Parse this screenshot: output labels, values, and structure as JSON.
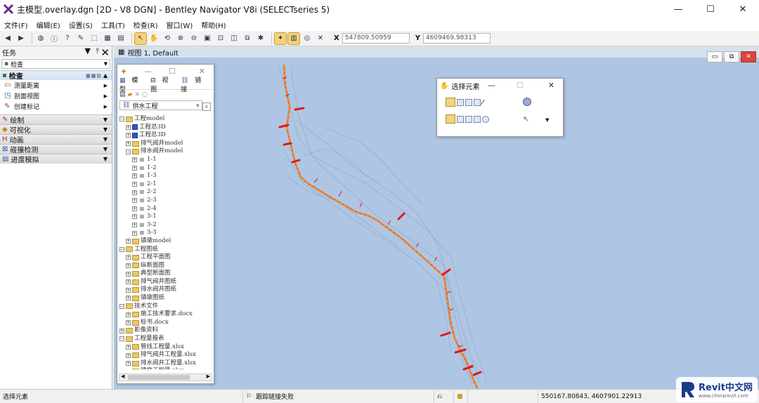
{
  "window": {
    "title": "主模型.overlay.dgn [2D - V8 DGN] - Bentley Navigator V8i (SELECTseries 5)",
    "minimize": "—",
    "maximize": "☐",
    "close": "✕"
  },
  "menu": [
    "文件(F)",
    "编辑(E)",
    "设置(S)",
    "工具(T)",
    "检查(R)",
    "窗口(W)",
    "帮助(H)"
  ],
  "toolbar": {
    "x_label": "X",
    "x_value": "547809.50959",
    "y_label": "Y",
    "y_value": "4609469.98313"
  },
  "task_panel": {
    "title": "任务",
    "select_value": "检查",
    "groups": [
      {
        "label": "检查",
        "expanded": true,
        "items": [
          "测量距离",
          "剖面视图",
          "创建标记"
        ]
      },
      {
        "label": "绘制",
        "expanded": false
      },
      {
        "label": "可视化",
        "expanded": false
      },
      {
        "label": "动画",
        "expanded": false
      },
      {
        "label": "碰撞检测",
        "expanded": false
      },
      {
        "label": "进度模拟",
        "expanded": false
      }
    ]
  },
  "view": {
    "title": "视图 1, Default"
  },
  "links_window": {
    "tabs": [
      "模型",
      "视图",
      "链接"
    ],
    "select_value": "供水工程",
    "tree": [
      {
        "level": 0,
        "label": "工程model",
        "icon": "folder",
        "exp": "−"
      },
      {
        "level": 1,
        "label": "工程总3D",
        "icon": "doc",
        "exp": "+"
      },
      {
        "level": 1,
        "label": "工程总3D",
        "icon": "doc",
        "exp": "+"
      },
      {
        "level": 1,
        "label": "排气阀井model",
        "icon": "folder",
        "exp": "+"
      },
      {
        "level": 1,
        "label": "排水阀井model",
        "icon": "folder",
        "exp": "−"
      },
      {
        "level": 2,
        "label": "1-1",
        "icon": "link",
        "exp": "+"
      },
      {
        "level": 2,
        "label": "1-2",
        "icon": "link",
        "exp": "+"
      },
      {
        "level": 2,
        "label": "1-3",
        "icon": "link",
        "exp": "+"
      },
      {
        "level": 2,
        "label": "2-1",
        "icon": "link",
        "exp": "+"
      },
      {
        "level": 2,
        "label": "2-2",
        "icon": "link",
        "exp": "+"
      },
      {
        "level": 2,
        "label": "2-3",
        "icon": "link",
        "exp": "+"
      },
      {
        "level": 2,
        "label": "2-4",
        "icon": "link",
        "exp": "+"
      },
      {
        "level": 2,
        "label": "3-1",
        "icon": "link",
        "exp": "+"
      },
      {
        "level": 2,
        "label": "3-2",
        "icon": "link",
        "exp": "+"
      },
      {
        "level": 2,
        "label": "3-3",
        "icon": "link",
        "exp": "+"
      },
      {
        "level": 1,
        "label": "镇墩model",
        "icon": "folder",
        "exp": "+"
      },
      {
        "level": 0,
        "label": "工程图纸",
        "icon": "folder",
        "exp": "−"
      },
      {
        "level": 1,
        "label": "工程平面图",
        "icon": "folder",
        "exp": "+"
      },
      {
        "level": 1,
        "label": "纵断面图",
        "icon": "folder",
        "exp": "+"
      },
      {
        "level": 1,
        "label": "典型断面图",
        "icon": "folder",
        "exp": "+"
      },
      {
        "level": 1,
        "label": "排气阀井图纸",
        "icon": "folder",
        "exp": "+"
      },
      {
        "level": 1,
        "label": "排水阀井图纸",
        "icon": "folder",
        "exp": "+"
      },
      {
        "level": 1,
        "label": "镇墩图纸",
        "icon": "folder",
        "exp": "+"
      },
      {
        "level": 0,
        "label": "技术文件",
        "icon": "folder",
        "exp": "−"
      },
      {
        "level": 1,
        "label": "施工技术要求.docx",
        "icon": "folder",
        "exp": "+"
      },
      {
        "level": 1,
        "label": "标书.docx",
        "icon": "folder",
        "exp": "+"
      },
      {
        "level": 0,
        "label": "影像资料",
        "icon": "folder",
        "exp": "+"
      },
      {
        "level": 0,
        "label": "工程量报表",
        "icon": "folder",
        "exp": "−"
      },
      {
        "level": 1,
        "label": "管线工程量.xlsx",
        "icon": "folder",
        "exp": "+"
      },
      {
        "level": 1,
        "label": "排气阀井工程量.xlsx",
        "icon": "folder",
        "exp": "+"
      },
      {
        "level": 1,
        "label": "排水阀井工程量.xlsx",
        "icon": "folder",
        "exp": "+"
      },
      {
        "level": 1,
        "label": "镇墩工程量.xlsx",
        "icon": "folder",
        "exp": "+"
      }
    ]
  },
  "select_dialog": {
    "title": "选择元素"
  },
  "status": {
    "left": "选择元素",
    "message": "跟踪链接失败",
    "coords": "550167.80843, 4607901.22913"
  },
  "watermark": {
    "brand": "Revit中文网",
    "url": "www.chinarevit.com"
  },
  "colors": {
    "view_bg": "#aec6e4",
    "pipeline": "#e8741c",
    "markers": "#e01818"
  }
}
